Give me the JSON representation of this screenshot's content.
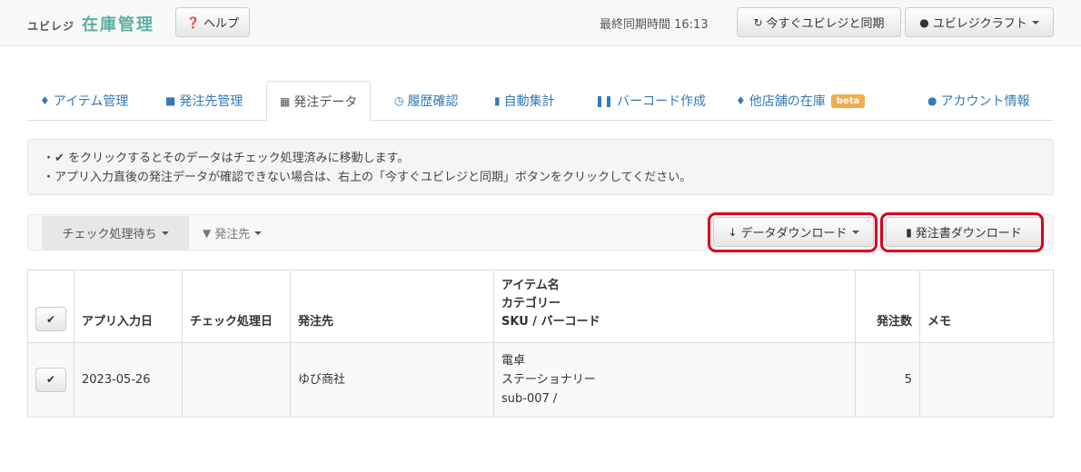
{
  "header": {
    "brand_small": "ユビレジ",
    "brand_big": "在庫管理",
    "help_label": "ヘルプ",
    "sync_time": "最終同期時間 16:13",
    "sync_label": "今すぐユビレジと同期",
    "account_label": "ユビレジクラフト"
  },
  "tabs": [
    {
      "label": "アイテム管理",
      "icon": "tag-icon"
    },
    {
      "label": "発注先管理",
      "icon": "book-icon"
    },
    {
      "label": "発注データ",
      "icon": "cart-icon"
    },
    {
      "label": "履歴確認",
      "icon": "clock-icon"
    },
    {
      "label": "自動集計",
      "icon": "file-icon"
    },
    {
      "label": "バーコード作成",
      "icon": "barcode-icon"
    },
    {
      "label": "他店舗の在庫",
      "icon": "tags-icon",
      "badge": "beta"
    },
    {
      "label": "アカウント情報",
      "icon": "user-icon"
    }
  ],
  "info": {
    "line1_prefix": "・",
    "line1_suffix": "をクリックするとそのデータはチェック処理済みに移動します。",
    "line2": "・アプリ入力直後の発注データが確認できない場合は、右上の「今すぐユビレジと同期」ボタンをクリックしてください。"
  },
  "filters": {
    "status_label": "チェック処理待ち",
    "supplier_label": "発注先",
    "download_data_label": "データダウンロード",
    "download_order_label": "発注書ダウンロード"
  },
  "table": {
    "headers": {
      "input_date": "アプリ入力日",
      "check_date": "チェック処理日",
      "supplier": "発注先",
      "item_line1": "アイテム名",
      "item_line2": "カテゴリー",
      "item_line3": "SKU / バーコード",
      "quantity": "発注数",
      "memo": "メモ"
    },
    "rows": [
      {
        "input_date": "2023-05-26",
        "check_date": "",
        "supplier": "ゆび商社",
        "item_name": "電卓",
        "category": "ステーショナリー",
        "sku": "sub-007 /",
        "quantity": "5",
        "memo": ""
      }
    ]
  },
  "colors": {
    "brand": "#5cb0a1",
    "link": "#337ab7",
    "highlight": "#d9001b",
    "beta_badge": "#f0ad4e"
  }
}
